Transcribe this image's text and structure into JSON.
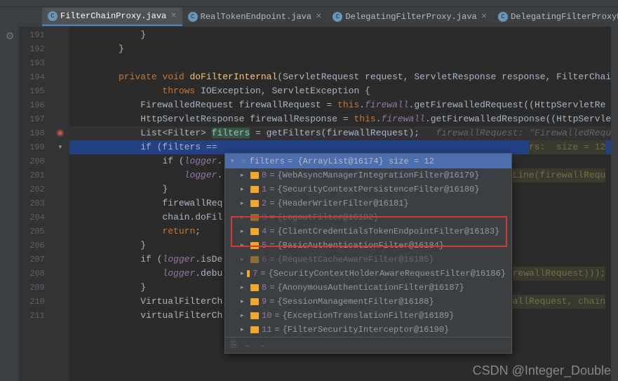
{
  "tabs": [
    {
      "label": "FilterChainProxy.java",
      "active": true
    },
    {
      "label": "RealTokenEndpoint.java",
      "active": false
    },
    {
      "label": "DelegatingFilterProxy.java",
      "active": false
    },
    {
      "label": "DelegatingFilterProxyRegistrationBean.ja",
      "active": false
    }
  ],
  "lines": {
    "191": "191",
    "192": "192",
    "193": "193",
    "194": "194",
    "195": "195",
    "196": "196",
    "197": "197",
    "198": "198",
    "199": "199",
    "200": "200",
    "201": "201",
    "202": "202",
    "203": "203",
    "204": "204",
    "205": "205",
    "206": "206",
    "207": "207",
    "208": "208",
    "209": "209",
    "210": "210",
    "211": "211"
  },
  "code": {
    "l191": "            }",
    "l192": "        }",
    "l193": "",
    "l194_private": "        private ",
    "l194_void": "void ",
    "l194_fn": "doFilterInternal",
    "l194_params": "(ServletRequest request, ServletResponse response, FilterChai",
    "l195_throws": "                throws ",
    "l195_exc": "IOException, ServletException {",
    "l196_a": "            FirewalledRequest firewallRequest = ",
    "l196_this": "this",
    "l196_b": ".",
    "l196_field": "firewall",
    "l196_c": ".getFirewalledRequest((HttpServletRe",
    "l197_a": "            HttpServletResponse firewallResponse = ",
    "l197_this": "this",
    "l197_b": ".",
    "l197_field": "firewall",
    "l197_c": ".getFirewalledResponse((HttpServle",
    "l198_a": "            List<Filter> ",
    "l198_b": "filters",
    "l198_c": " = getFilters(firewallRequest);",
    "l198_hint": "   firewallRequest: \"FirewalledRequ",
    "l199_a": "            if (filters == ",
    "l199_hint": "rs:  size = 12",
    "l200_a": "                if (",
    "l200_b": "logger",
    "l200_c": ".",
    "l201_a": "                    ",
    "l201_b": "logger",
    "l201_c": ".",
    "l201_hint": "uestLine(firewallRequ",
    "l202": "                }",
    "l203": "                firewallReq",
    "l204": "                chain.doFil",
    "l205_a": "                ",
    "l205_ret": "return",
    "l205_b": ";",
    "l206": "            }",
    "l207_a": "            if (",
    "l207_b": "logger",
    "l207_c": ".isDe",
    "l208_a": "                ",
    "l208_b": "logger",
    "l208_c": ".debu",
    "l208_hint": "rewallRequest)));",
    "l209": "            }",
    "l210_a": "            VirtualFilterCh",
    "l210_hint": "rewallRequest, chain",
    "l211": "            virtualFilterCh"
  },
  "popup": {
    "header_var": "filters",
    "header_val": " = {ArrayList@16174}  size = 12",
    "items": [
      {
        "idx": "0",
        "val": "{WebAsyncManagerIntegrationFilter@16179}",
        "dim": false
      },
      {
        "idx": "1",
        "val": "{SecurityContextPersistenceFilter@16180}",
        "dim": false
      },
      {
        "idx": "2",
        "val": "{HeaderWriterFilter@16181}",
        "dim": false
      },
      {
        "idx": "3",
        "val": "{LogoutFilter@16182}",
        "dim": true
      },
      {
        "idx": "4",
        "val": "{ClientCredentialsTokenEndpointFilter@16183}",
        "dim": false
      },
      {
        "idx": "5",
        "val": "{BasicAuthenticationFilter@16184}",
        "dim": false
      },
      {
        "idx": "6",
        "val": "{RequestCacheAwareFilter@16185}",
        "dim": true
      },
      {
        "idx": "7",
        "val": "{SecurityContextHolderAwareRequestFilter@16186}",
        "dim": false
      },
      {
        "idx": "8",
        "val": "{AnonymousAuthenticationFilter@16187}",
        "dim": false
      },
      {
        "idx": "9",
        "val": "{SessionManagementFilter@16188}",
        "dim": false
      },
      {
        "idx": "10",
        "val": "{ExceptionTranslationFilter@16189}",
        "dim": false
      },
      {
        "idx": "11",
        "val": "{FilterSecurityInterceptor@16190}",
        "dim": false
      }
    ]
  },
  "watermark": "CSDN @Integer_Double"
}
